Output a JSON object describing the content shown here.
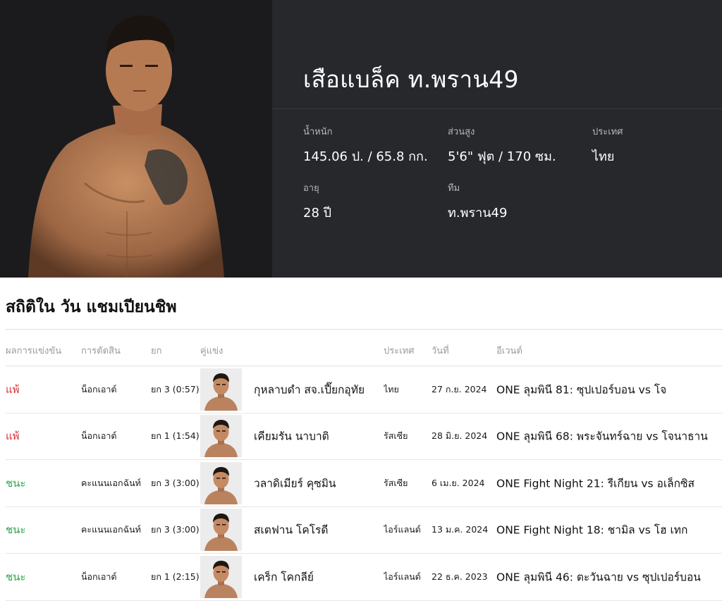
{
  "profile": {
    "name": "เสือแบล็ค ท.พราน49",
    "stats": {
      "weight": {
        "label": "น้ำหนัก",
        "value": "145.06 ป. / 65.8 กก."
      },
      "height": {
        "label": "ส่วนสูง",
        "value": "5'6\" ฟุต / 170 ซม."
      },
      "country": {
        "label": "ประเทศ",
        "value": "ไทย"
      },
      "age": {
        "label": "อายุ",
        "value": "28 ปี"
      },
      "team": {
        "label": "ทีม",
        "value": "ท.พราน49"
      }
    }
  },
  "record": {
    "title": "สถิติใน วัน แชมเปียนชิพ",
    "columns": {
      "result": "ผลการแข่งขัน",
      "method": "การตัดสิน",
      "round": "ยก",
      "opponent": "คู่แข่ง",
      "country": "ประเทศ",
      "date": "วันที่",
      "event": "อีเวนต์"
    },
    "rows": [
      {
        "result": "แพ้",
        "outcome": "loss",
        "method": "น็อกเอาต์",
        "round": "ยก 3 (0:57)",
        "opponent": "กุหลาบดำ สจ.เปี๊ยกอุทัย",
        "country": "ไทย",
        "date": "27 ก.ย. 2024",
        "event": "ONE ลุมพินี 81: ซุปเปอร์บอน vs โจ"
      },
      {
        "result": "แพ้",
        "outcome": "loss",
        "method": "น็อกเอาต์",
        "round": "ยก 1 (1:54)",
        "opponent": "เคียมรัน นาบาติ",
        "country": "รัสเซีย",
        "date": "28 มิ.ย. 2024",
        "event": "ONE ลุมพินี 68: พระจันทร์ฉาย vs โจนาธาน"
      },
      {
        "result": "ชนะ",
        "outcome": "win",
        "method": "คะแนนเอกฉันท์",
        "round": "ยก 3 (3:00)",
        "opponent": "วลาดิเมียร์ คุซมิน",
        "country": "รัสเซีย",
        "date": "6 เม.ย. 2024",
        "event": "ONE Fight Night 21: รีเกียน vs อเล็กซิส"
      },
      {
        "result": "ชนะ",
        "outcome": "win",
        "method": "คะแนนเอกฉันท์",
        "round": "ยก 3 (3:00)",
        "opponent": "สเตฟาน โคโรดี",
        "country": "ไอร์แลนด์",
        "date": "13 ม.ค. 2024",
        "event": "ONE Fight Night 18: ชามิล vs โฮ เทก"
      },
      {
        "result": "ชนะ",
        "outcome": "win",
        "method": "น็อกเอาต์",
        "round": "ยก 1 (2:15)",
        "opponent": "เคร็ก โคกลีย์",
        "country": "ไอร์แลนด์",
        "date": "22 ธ.ค. 2023",
        "event": "ONE ลุมพินี 46: ตะวันฉาย vs ซุปเปอร์บอน"
      }
    ]
  },
  "colors": {
    "loss": "#d8323a",
    "win": "#2ea44a",
    "header_bg": "#27282c",
    "photo_bg": "#1b1b1d"
  }
}
